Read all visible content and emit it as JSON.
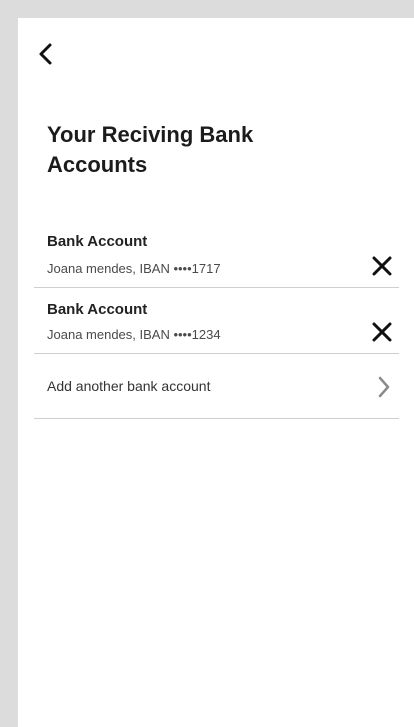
{
  "header": {
    "back_icon": "chevron-left-icon",
    "title": "Your Reciving Bank Accounts"
  },
  "accounts": [
    {
      "title": "Bank Account",
      "detail": "Joana mendes, IBAN ••••1717",
      "action_icon": "close-icon"
    },
    {
      "title": "Bank Account",
      "detail": "Joana mendes, IBAN ••••1234",
      "action_icon": "close-icon"
    }
  ],
  "add_account": {
    "label": "Add another bank account",
    "icon": "chevron-right-icon"
  },
  "colors": {
    "text": "#1c1c1c",
    "divider": "#cfcfcf",
    "chevron": "#8a8a8a",
    "background_outer": "#dcdcdc"
  }
}
